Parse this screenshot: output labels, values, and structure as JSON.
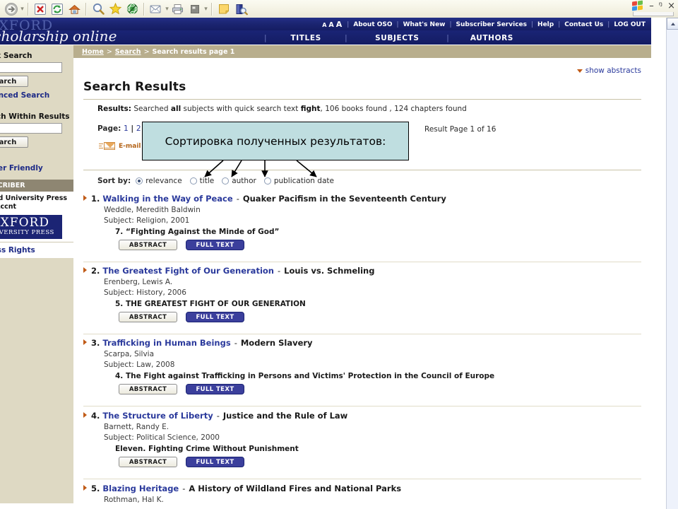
{
  "browser": {
    "toolbar_icons": [
      "forward-arrow-icon",
      "stop-icon",
      "refresh-icon",
      "home-icon",
      "search-icon",
      "favorites-star-icon",
      "history-icon",
      "mail-icon",
      "print-icon",
      "edit-icon",
      "notes-icon",
      "research-icon"
    ],
    "window_controls": {
      "minimize": "–",
      "restore": "ᵑ",
      "close": "×"
    }
  },
  "site": {
    "logo_top": "OXFORD",
    "logo_bottom": "scholarship online",
    "util_nav": [
      "About OSO",
      "What's New",
      "Subscriber Services",
      "Help",
      "Contact Us",
      "LOG OUT"
    ],
    "text_size_label": "A A A",
    "main_nav": [
      "TITLES",
      "SUBJECTS",
      "AUTHORS"
    ]
  },
  "breadcrumb": {
    "items": [
      "Home",
      "Search",
      "Search results page 1"
    ],
    "separator": ">"
  },
  "sidebar": {
    "quick_search_label": "Quick Search",
    "quick_search_value": "",
    "quick_search_button": "Search",
    "advanced_search_link": "Advanced Search",
    "within_label": "Search Within Results",
    "within_value": "",
    "within_button": "Search",
    "printer_friendly_link": "Printer Friendly",
    "subscriber_header": "SUBSCRIBER",
    "account_line1": "Oxford University Press",
    "account_line2": "Test Accnt",
    "oup_logo_line1": "OXFORD",
    "oup_logo_line2": "UNIVERSITY PRESS",
    "access_rights_link": "Access Rights"
  },
  "main": {
    "show_abstracts": "show abstracts",
    "page_title": "Search Results",
    "results_prefix": "Results:",
    "results_text_1": "Searched",
    "results_scope": "all",
    "results_text_2": "subjects with quick search text",
    "results_query": "fight",
    "results_counts": ", 106 books found , 124 chapters found",
    "page_label": "Page:",
    "page_links": [
      "1",
      "2"
    ],
    "result_page_of": "Result Page 1 of 16",
    "email_label": "E-mail",
    "sort_by_label": "Sort by:",
    "sort_options": [
      {
        "label": "relevance",
        "selected": true
      },
      {
        "label": "title",
        "selected": false
      },
      {
        "label": "author",
        "selected": false
      },
      {
        "label": "publication date",
        "selected": false
      }
    ],
    "abstract_button": "ABSTRACT",
    "fulltext_button": "FULL TEXT"
  },
  "results": [
    {
      "num": "1.",
      "title": "Walking in the Way of Peace",
      "subtitle": "Quaker Pacifism in the Seventeenth Century",
      "author": "Weddle, Meredith Baldwin",
      "subject": "Subject: Religion, 2001",
      "chapter": "7. “Fighting Against the Minde of God”"
    },
    {
      "num": "2.",
      "title": "The Greatest Fight of Our Generation",
      "subtitle": "Louis vs. Schmeling",
      "author": "Erenberg, Lewis A.",
      "subject": "Subject: History, 2006",
      "chapter": "5. THE GREATEST FIGHT OF OUR GENERATION"
    },
    {
      "num": "3.",
      "title": "Trafficking in Human Beings",
      "subtitle": "Modern Slavery",
      "author": "Scarpa, Silvia",
      "subject": "Subject: Law, 2008",
      "chapter": "4. The Fight against Trafficking in Persons and Victims' Protection in the Council of Europe"
    },
    {
      "num": "4.",
      "title": "The Structure of Liberty",
      "subtitle": "Justice and the Rule of Law",
      "author": "Barnett, Randy E.",
      "subject": "Subject: Political Science, 2000",
      "chapter": "Eleven. Fighting Crime Without Punishment"
    },
    {
      "num": "5.",
      "title": "Blazing Heritage",
      "subtitle": "A History of Wildland Fires and National Parks",
      "author": "Rothman, Hal K.",
      "subject": "",
      "chapter": ""
    }
  ],
  "annotation": {
    "text": "Сортировка полученных результатов:",
    "arrow_count": 4,
    "background": "#bfdee0",
    "border": "#000000"
  },
  "colors": {
    "header_blue": "#1b2474",
    "link_blue": "#2b3a9c",
    "crumb_tan": "#b8ae8d",
    "sidebar_tan": "#ded9c3",
    "accent_orange": "#c05a16",
    "fulltext_button": "#3b3f9c"
  }
}
